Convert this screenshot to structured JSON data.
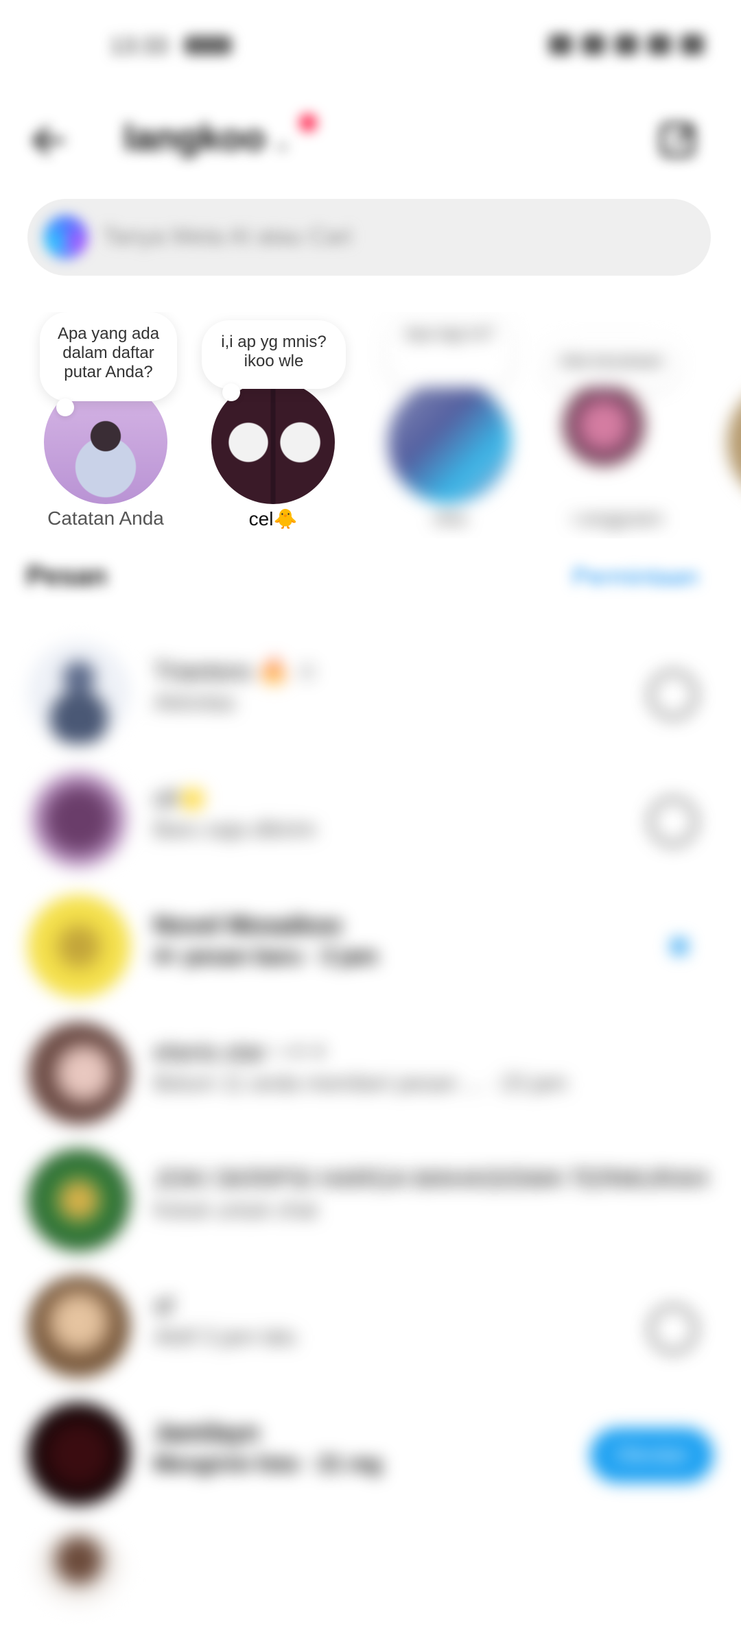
{
  "status_bar": {
    "time": "13:33"
  },
  "header": {
    "account_name": "langkoo",
    "chevron": "⌄",
    "icons": {
      "back": "arrow-left-icon",
      "compose": "new-message-icon"
    }
  },
  "search": {
    "placeholder": "Tanya Meta AI atau Cari"
  },
  "notes": [
    {
      "name": "Catatan Anda",
      "note": "Apa yang ada dalam daftar putar Anda?"
    },
    {
      "name": "cel🐥",
      "note": "i,i ap yg mnis? ikoo wle"
    },
    {
      "name": "vika",
      "note": "Apa lagi ini?"
    },
    {
      "name": "r.anggraen",
      "note": "Ada kesukaan"
    }
  ],
  "messages_section": {
    "title": "Pesan",
    "requests_label": "Permintaan"
  },
  "conversations": [
    {
      "name": "Triantoro 🔥 ☆",
      "preview": "Aktivitas"
    },
    {
      "name": "cil🌟",
      "preview": "Baru saja dikirim"
    },
    {
      "name": "Novel Mosaikoo",
      "preview": "4+ pesan baru · 3 jam"
    },
    {
      "name": "elanis.star ~✧✧",
      "preview": "Belum 11 anda memberi pesan ... · 23 jam"
    },
    {
      "name": "JOKI SKRIPSI HARGA MAHASISWA TERMURAH",
      "preview": "Ketuk untuk chat"
    },
    {
      "name": "sf",
      "preview": "Aktif 3 jam lalu"
    },
    {
      "name": "Jamilayn",
      "preview": "Mengirim foto · 21 mg",
      "chat_button": "Obrolan"
    }
  ]
}
